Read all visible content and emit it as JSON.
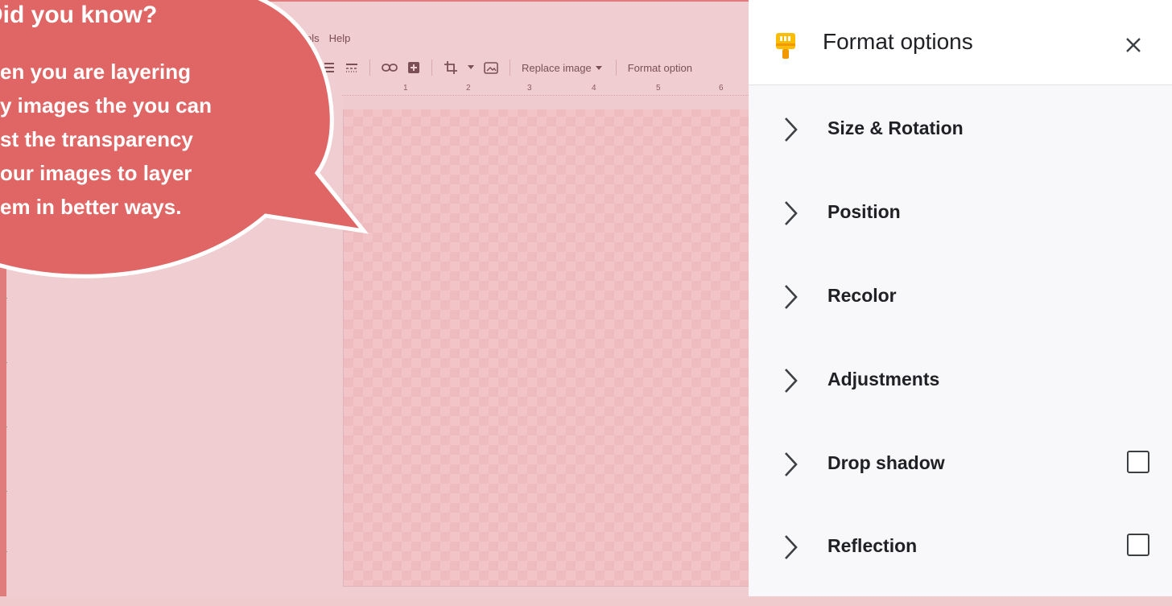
{
  "editor": {
    "menu": [
      "ols",
      "Help"
    ],
    "toolbar": {
      "replace_image_label": "Replace image",
      "format_options_label": "Format option"
    },
    "ruler_marks": [
      "1",
      "2",
      "3",
      "4",
      "5",
      "6"
    ]
  },
  "callout": {
    "title": "Did you know?",
    "lines": [
      "en you are layering",
      "y images the you can",
      "st the transparency",
      "our images to layer",
      "em in better ways."
    ]
  },
  "panel": {
    "title": "Format options",
    "sections": [
      {
        "label": "Size & Rotation",
        "checkbox": false
      },
      {
        "label": "Position",
        "checkbox": false
      },
      {
        "label": "Recolor",
        "checkbox": false
      },
      {
        "label": "Adjustments",
        "checkbox": false
      },
      {
        "label": "Drop shadow",
        "checkbox": true,
        "checked": false
      },
      {
        "label": "Reflection",
        "checkbox": true,
        "checked": false
      }
    ]
  },
  "colors": {
    "bubble": "#e06666",
    "editor_tint": "#efcdd0",
    "panel_bg": "#f8f8fa",
    "brush_icon": "#fbbc04"
  }
}
